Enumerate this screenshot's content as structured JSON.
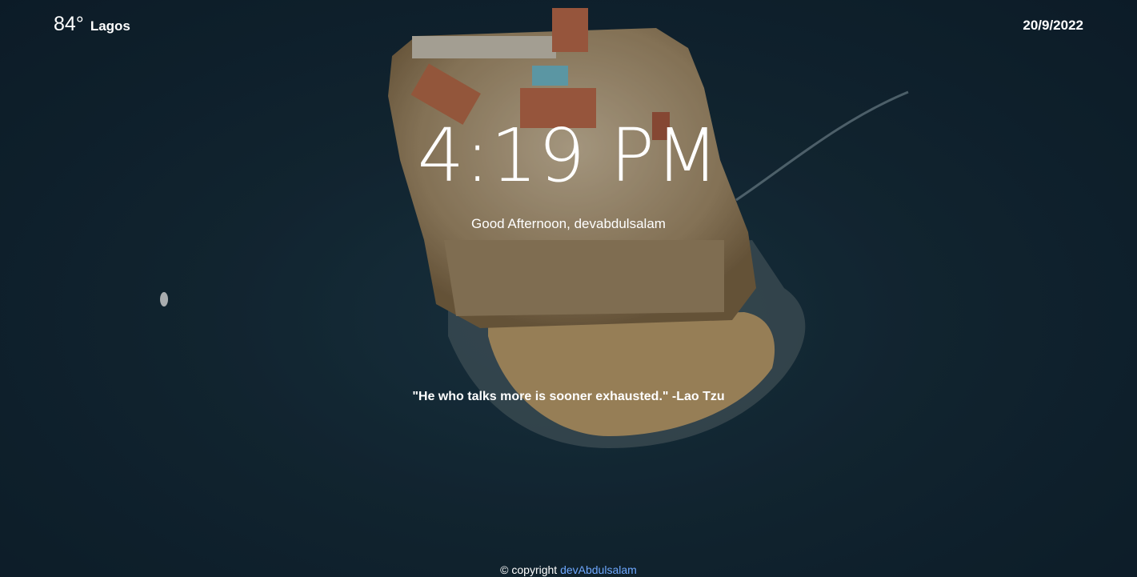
{
  "weather": {
    "temperature": "84°",
    "city": "Lagos"
  },
  "date": "20/9/2022",
  "clock": {
    "time": "4:19 PM"
  },
  "greeting": "Good Afternoon, devabdulsalam",
  "quote": "\"He who talks more is sooner exhausted.\" -Lao Tzu",
  "footer": {
    "copyright_text": "© copyright",
    "author_link": "devAbdulsalam"
  },
  "colors": {
    "sea": "#152c3a",
    "link": "#6ea8ff",
    "text": "#ffffff"
  }
}
